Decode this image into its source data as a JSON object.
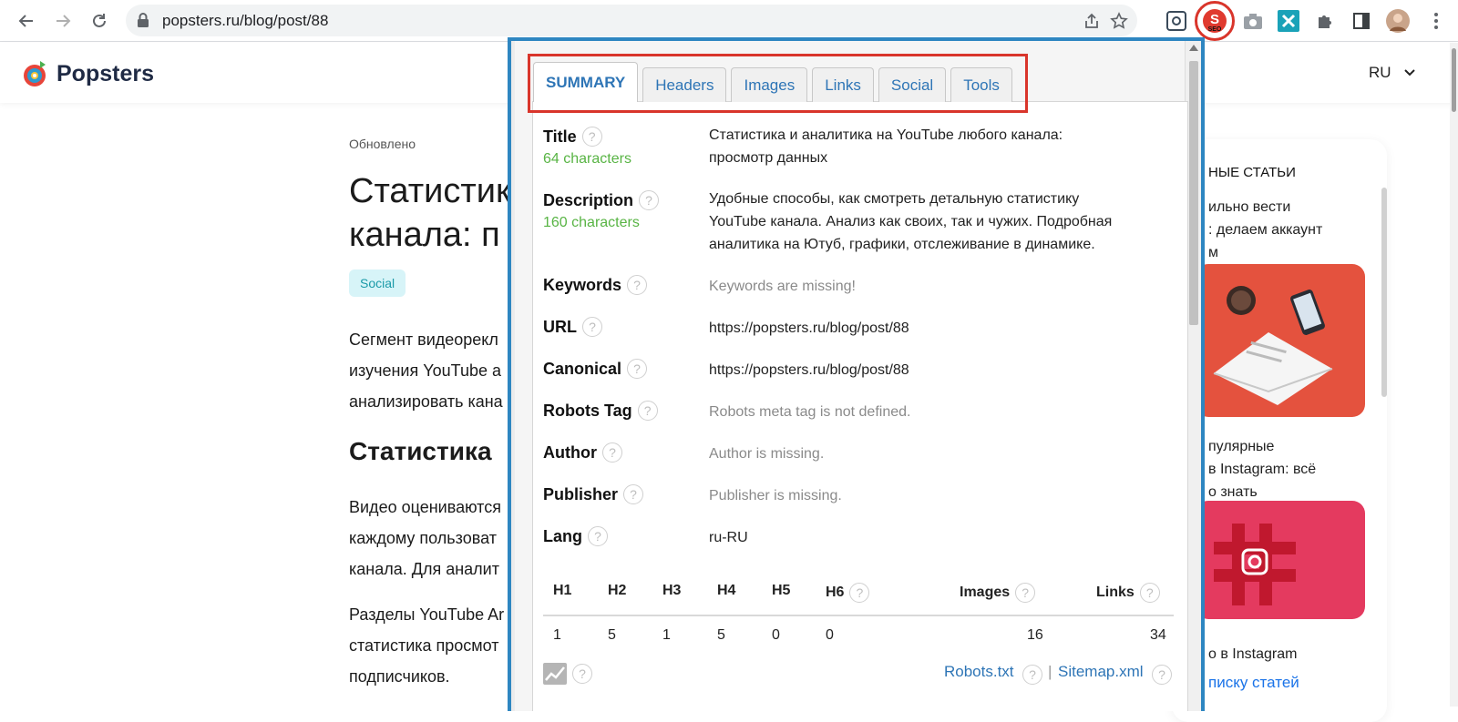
{
  "browser": {
    "url": "popsters.ru/blog/post/88"
  },
  "site": {
    "brand": "Popsters",
    "language": "RU"
  },
  "article": {
    "updated_label": "Обновлено",
    "title_line1": "Статистик",
    "title_line2": "канала: п",
    "tag": "Social",
    "para1": [
      "Сегмент видеорекл",
      "изучения YouTube а",
      "анализировать кана"
    ],
    "h2": "Статистика",
    "para2": [
      "Видео оцениваются",
      "каждому пользоват",
      "канала. Для аналит"
    ],
    "para3": [
      "Разделы YouTube Ar",
      "статистика просмот",
      "подписчиков."
    ]
  },
  "sidebar": {
    "heading": "НЫЕ СТАТЬИ",
    "item1": [
      "ильно вести",
      ": делаем аккаунт",
      "м"
    ],
    "item2": [
      "пулярные",
      "в Instagram: всё",
      "о знать"
    ],
    "item3": "о в Instagram",
    "link": "писку статей"
  },
  "seo": {
    "tabs": [
      "SUMMARY",
      "Headers",
      "Images",
      "Links",
      "Social",
      "Tools"
    ],
    "title": {
      "label": "Title",
      "sub": "64 characters",
      "value": [
        "Статистика и аналитика на YouTube любого канала:",
        "просмотр данных"
      ]
    },
    "description": {
      "label": "Description",
      "sub": "160 characters",
      "value": [
        "Удобные способы, как смотреть детальную статистику",
        "YouTube канала. Анализ как своих, так и чужих. Подробная",
        "аналитика на Ютуб, графики, отслеживание в динамике."
      ]
    },
    "keywords": {
      "label": "Keywords",
      "value": "Keywords are missing!"
    },
    "url": {
      "label": "URL",
      "value": "https://popsters.ru/blog/post/88"
    },
    "canonical": {
      "label": "Canonical",
      "value": "https://popsters.ru/blog/post/88"
    },
    "robots": {
      "label": "Robots Tag",
      "value": "Robots meta tag is not defined."
    },
    "author": {
      "label": "Author",
      "value": "Author is missing."
    },
    "publisher": {
      "label": "Publisher",
      "value": "Publisher is missing."
    },
    "lang": {
      "label": "Lang",
      "value": "ru-RU"
    },
    "stats": {
      "headers": [
        "H1",
        "H2",
        "H3",
        "H4",
        "H5",
        "H6"
      ],
      "header_counts": [
        "1",
        "5",
        "1",
        "5",
        "0",
        "0"
      ],
      "images_label": "Images",
      "images_count": "16",
      "links_label": "Links",
      "links_count": "34"
    },
    "footer": {
      "robots_link": "Robots.txt",
      "separator": "|",
      "sitemap_link": "Sitemap.xml"
    }
  },
  "colors": {
    "accent": "#2e75b6",
    "highlight": "#d9352b",
    "green": "#58b444"
  },
  "help_glyph": "?"
}
